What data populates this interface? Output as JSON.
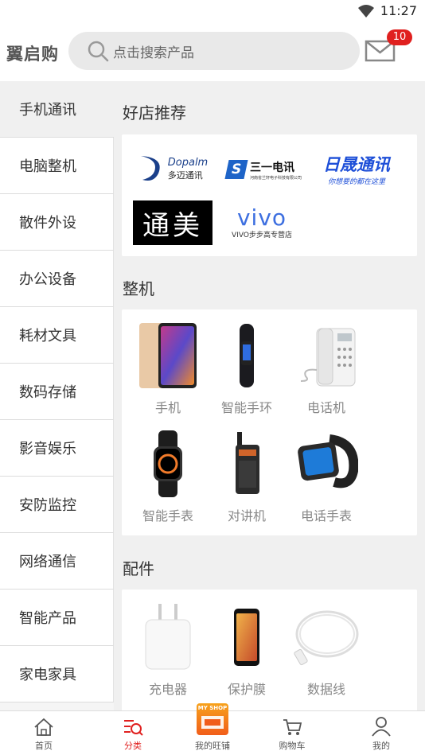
{
  "status": {
    "time": "11:27"
  },
  "header": {
    "brand": "翼启购",
    "search_placeholder": "点击搜索产品",
    "mail_badge": "10"
  },
  "sidebar": {
    "items": [
      {
        "label": "手机通讯",
        "active": true
      },
      {
        "label": "电脑整机"
      },
      {
        "label": "散件外设"
      },
      {
        "label": "办公设备"
      },
      {
        "label": "耗材文具"
      },
      {
        "label": "数码存储"
      },
      {
        "label": "影音娱乐"
      },
      {
        "label": "安防监控"
      },
      {
        "label": "网络通信"
      },
      {
        "label": "智能产品"
      },
      {
        "label": "家电家具"
      }
    ]
  },
  "sections": {
    "shops": {
      "title": "好店推荐",
      "logos": {
        "dopalm_name": "Dopalm",
        "dopalm_cn": "多迈通讯",
        "sanyi_name": "三一电讯",
        "sanyi_sub": "河南省兰轩电子科技有限公司",
        "risheng_name": "日晟通讯",
        "risheng_sub": "你想要的都在这里",
        "tongmei_name": "通美",
        "vivo_name": "vivo",
        "vivo_sub": "VIVO步步高专营店"
      }
    },
    "devices": {
      "title": "整机",
      "items": [
        {
          "label": "手机",
          "icon": "phone-product"
        },
        {
          "label": "智能手环",
          "icon": "smart-band-product"
        },
        {
          "label": "电话机",
          "icon": "desk-phone-product"
        },
        {
          "label": "智能手表",
          "icon": "smart-watch-product"
        },
        {
          "label": "对讲机",
          "icon": "walkie-talkie-product"
        },
        {
          "label": "电话手表",
          "icon": "phone-watch-product"
        }
      ]
    },
    "accessories": {
      "title": "配件",
      "items": [
        {
          "label": "充电器",
          "icon": "charger-product"
        },
        {
          "label": "保护膜",
          "icon": "screen-protector-product"
        },
        {
          "label": "数据线",
          "icon": "cable-product"
        }
      ]
    }
  },
  "tabbar": {
    "home": "首页",
    "category": "分类",
    "myshop": "我的旺铺",
    "myshop_badge": "MY SHOP",
    "cart": "购物车",
    "mine": "我的"
  },
  "colors": {
    "accent": "#e0201f",
    "background": "#f0f0f0"
  }
}
